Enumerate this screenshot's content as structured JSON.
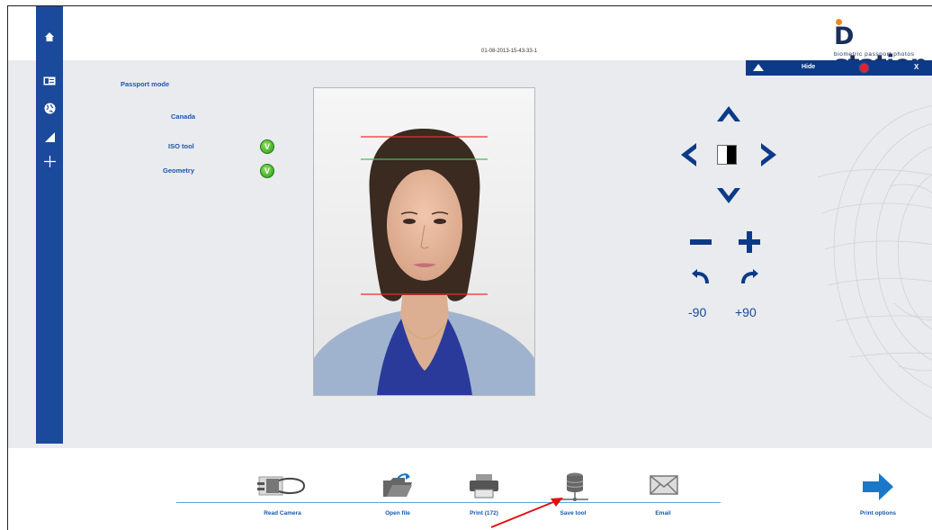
{
  "header": {
    "timestamp": "01-08-2013-15-43-33-1",
    "logo_text": "station",
    "logo_letter": "D",
    "logo_tagline": "biometric passport photos"
  },
  "topbar": {
    "hide_label": "Hide",
    "close_label": "X"
  },
  "sidebar": {
    "items": [
      {
        "icon": "home-icon"
      },
      {
        "icon": "id-card-icon"
      },
      {
        "icon": "globe-icon"
      },
      {
        "icon": "ruler-triangle-icon"
      },
      {
        "icon": "crosshair-icon"
      }
    ]
  },
  "settings": {
    "mode": "Passport mode",
    "country": "Canada",
    "iso_tool": "ISO tool",
    "geometry": "Geometry",
    "check_glyph": "V"
  },
  "controls": {
    "rotate_left_90": "-90",
    "rotate_right_90": "+90"
  },
  "toolbar": {
    "read_camera": "Read Camera",
    "open_file": "Open file",
    "print": "Print (172)",
    "save_tool": "Save tool",
    "email": "Email",
    "print_options": "Print options"
  },
  "colors": {
    "sidebar": "#1b4a9c",
    "accent_blue": "#1a56b0",
    "topbar": "#0c3a88",
    "check_green": "#2c9a1c",
    "guide_red": "#e83030",
    "guide_green": "#3cc060",
    "annotation_arrow": "#e01010"
  }
}
